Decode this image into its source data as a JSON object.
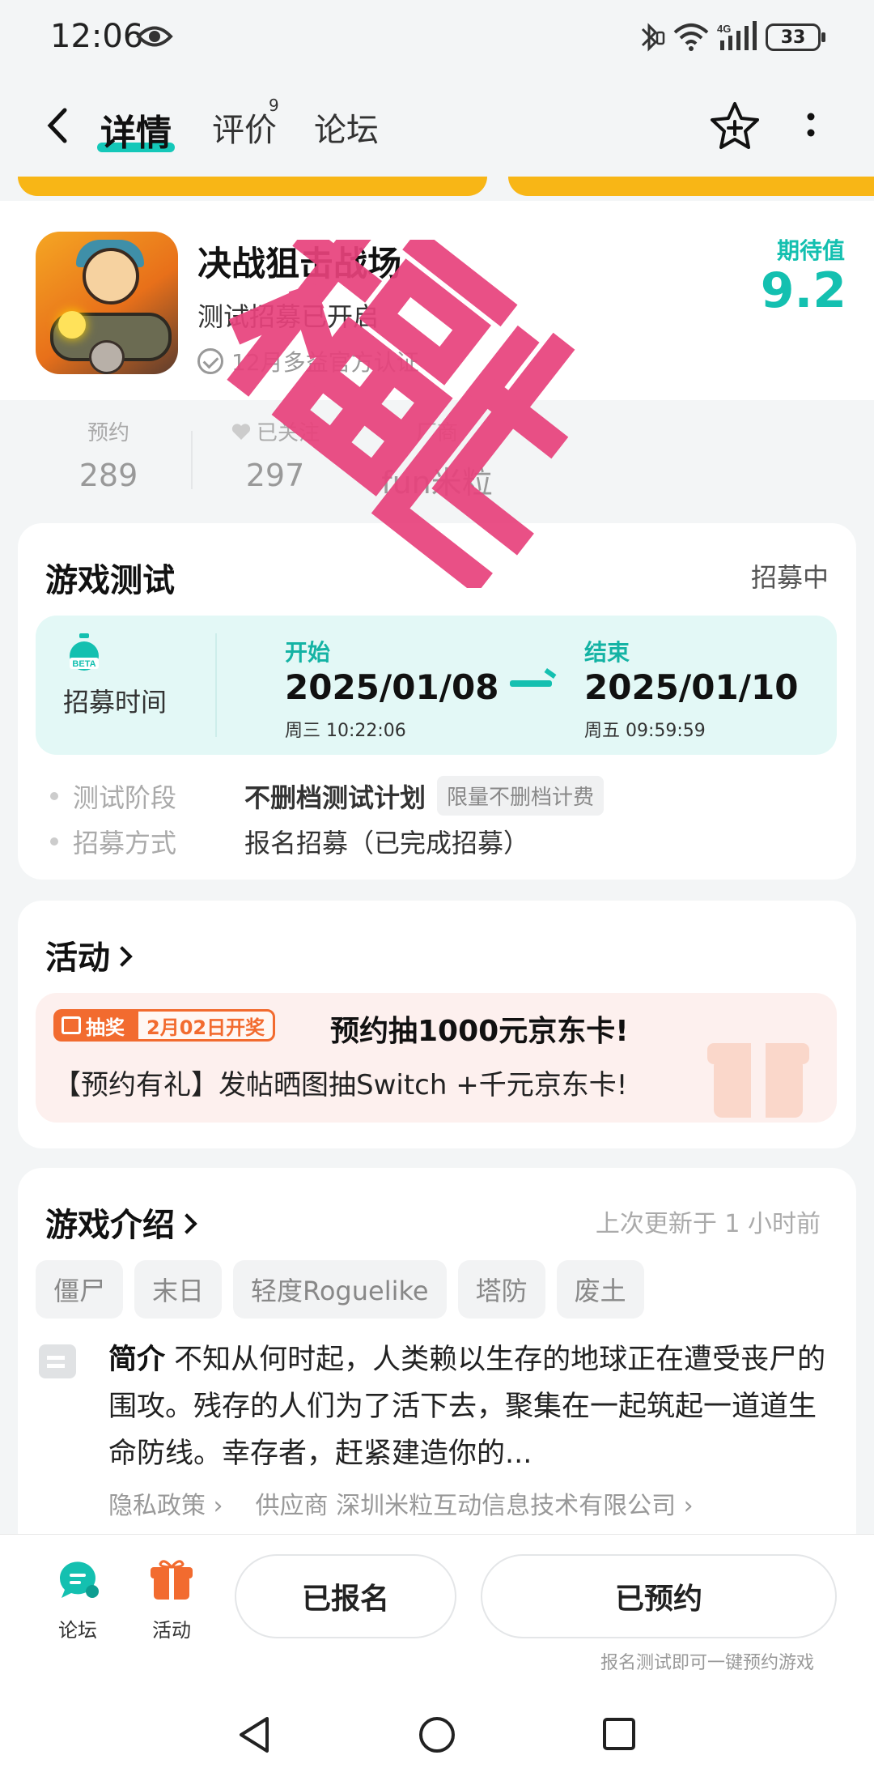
{
  "status_bar": {
    "time": "12:06",
    "network": "4G",
    "battery": "33"
  },
  "nav": {
    "tabs": [
      {
        "label": "详情",
        "active": true
      },
      {
        "label": "评价",
        "badge": "9"
      },
      {
        "label": "论坛"
      }
    ]
  },
  "game": {
    "title": "决战狙击战场",
    "subtitle": "测试招募已开启",
    "verify_text": "12月多益官方认证",
    "expect_label": "期待值",
    "expect_value": "9.2",
    "stamp_text": "福利"
  },
  "stats": [
    {
      "label": "预约",
      "value": "289"
    },
    {
      "label": "已关注",
      "value": "297"
    },
    {
      "label": "厂商",
      "value": "fun米粒"
    }
  ],
  "test_card": {
    "title": "游戏测试",
    "status": "招募中",
    "recruit_label": "招募时间",
    "start_label": "开始",
    "start_date": "2025/01/08",
    "start_time": "周三  10:22:06",
    "end_label": "结束",
    "end_date": "2025/01/10",
    "end_time": "周五  09:59:59",
    "phase_key": "测试阶段",
    "phase_value": "不删档测试计划",
    "phase_tag": "限量不删档计费",
    "method_key": "招募方式",
    "method_value": "报名招募（已完成招募）"
  },
  "activity_card": {
    "title": "活动",
    "badge_draw": "抽奖",
    "badge_date": "2月02日开奖",
    "promo_title": "预约抽1000元京东卡!",
    "promo_desc": "【预约有礼】发帖晒图抽Switch +千元京东卡!"
  },
  "intro_card": {
    "title": "游戏介绍",
    "updated": "上次更新于 1 小时前",
    "tags": [
      "僵尸",
      "末日",
      "轻度Roguelike",
      "塔防",
      "废土"
    ],
    "intro_label": "简介",
    "intro_text": "不知从何时起，人类赖以生存的地球正在遭受丧尸的围攻。残存的人们为了活下去，聚集在一起筑起一道道生命防线。幸存者，赶紧建造你的...",
    "privacy_link": "隐私政策",
    "supplier_link": "供应商 深圳米粒互动信息技术有限公司"
  },
  "bottom": {
    "forum_label": "论坛",
    "activity_label": "活动",
    "registered_label": "已报名",
    "reserved_label": "已预约",
    "note": "报名测试即可一键预约游戏"
  },
  "colors": {
    "accent": "#14c0b0",
    "stamp": "#e8427c",
    "orange": "#f26b2f",
    "banner": "#f8b616"
  },
  "icons": [
    "back-arrow-icon",
    "eye-icon",
    "bluetooth-icon",
    "wifi-icon",
    "signal-icon",
    "battery-icon",
    "star-add-icon",
    "more-vertical-icon",
    "verify-check-icon",
    "heart-icon",
    "beta-timer-icon",
    "gift-icon",
    "doc-icon",
    "forum-bubble-icon",
    "nav-back-icon",
    "nav-home-icon",
    "nav-recent-icon"
  ]
}
